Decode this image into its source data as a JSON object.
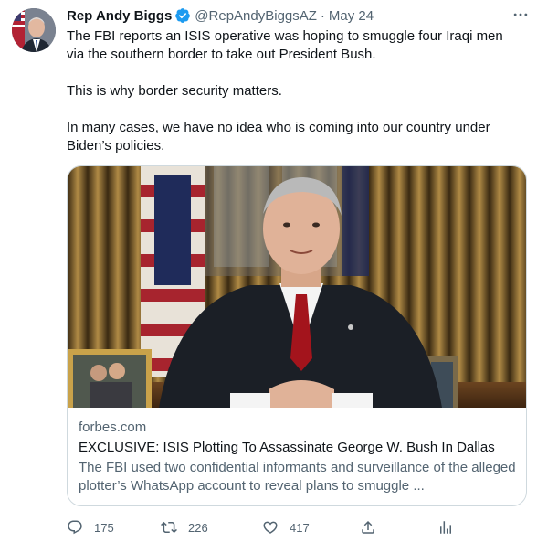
{
  "tweet": {
    "author_name": "Rep Andy Biggs",
    "handle": "@RepAndyBiggsAZ",
    "separator": "·",
    "date": "May 24",
    "paragraphs": [
      "The FBI reports an ISIS operative was hoping to smuggle four Iraqi men via the southern border to take out President Bush.",
      "This is why border security matters.",
      "In many cases, we have no idea who is coming into our country under Biden’s policies."
    ],
    "card": {
      "domain": "forbes.com",
      "title": "EXCLUSIVE: ISIS Plotting To Assassinate George W. Bush In Dallas",
      "description": "The FBI used two confidential informants and surveillance of the alleged plotter’s WhatsApp account to reveal plans to smuggle ..."
    },
    "actions": {
      "reply_count": "175",
      "retweet_count": "226",
      "like_count": "417"
    }
  },
  "icons": {
    "verified": "verified-badge-icon",
    "more": "more-options-icon",
    "reply": "reply-icon",
    "retweet": "retweet-icon",
    "like": "heart-icon",
    "share": "share-icon",
    "analytics": "analytics-icon"
  },
  "colors": {
    "accent": "#1d9bf0",
    "text_primary": "#0f1419",
    "text_secondary": "#536471",
    "border": "#cfd9de"
  }
}
